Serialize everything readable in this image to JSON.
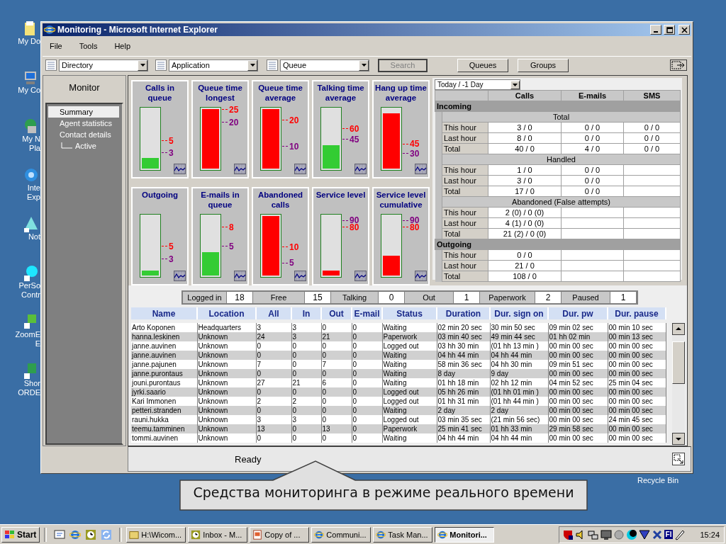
{
  "desktop_icons": [
    {
      "lines": [
        "My Do"
      ]
    },
    {
      "lines": [
        "My Co"
      ]
    },
    {
      "lines": [
        "My N",
        "Pla"
      ]
    },
    {
      "lines": [
        "Inte",
        "Exp"
      ]
    },
    {
      "lines": [
        "Not"
      ]
    },
    {
      "lines": [
        "PerSo",
        "Contr"
      ]
    },
    {
      "lines": [
        "ZoomE",
        "E"
      ]
    },
    {
      "lines": [
        "Shor",
        "ORDE"
      ]
    }
  ],
  "recycle_bin": {
    "label": "Recycle Bin"
  },
  "window": {
    "title": "Monitoring - Microsoft Internet Explorer"
  },
  "menu": [
    "File",
    "Tools",
    "Help"
  ],
  "toolbar": {
    "dropdowns": [
      "Directory",
      "Application",
      "Queue"
    ],
    "search": {
      "label": "Search",
      "disabled": true
    },
    "buttons": [
      "Queues",
      "Groups"
    ]
  },
  "sidebar": {
    "title": "Monitor",
    "items": [
      {
        "label": "Summary",
        "selected": true
      },
      {
        "label": "Agent statistics",
        "selected": false
      },
      {
        "label": "Contact details",
        "selected": false,
        "children": [
          {
            "label": "Active",
            "selected": false
          }
        ]
      }
    ]
  },
  "gauges": [
    {
      "title": "Calls in queue",
      "level": 0.18,
      "color": "#33cc33",
      "ticks": [
        {
          "label": "5",
          "color": "#ff0000"
        },
        {
          "label": "3",
          "color": "#800080"
        }
      ]
    },
    {
      "title": "Queue time longest",
      "level": 1,
      "color": "#ff0000",
      "ticks": [
        {
          "label": "25",
          "color": "#ff0000"
        },
        {
          "label": "20",
          "color": "#800080"
        }
      ]
    },
    {
      "title": "Queue time average",
      "level": 1,
      "color": "#ff0000",
      "ticks": [
        {
          "label": "20",
          "color": "#ff0000"
        },
        {
          "label": "10",
          "color": "#800080"
        }
      ]
    },
    {
      "title": "Talking time average",
      "level": 0.39,
      "color": "#33cc33",
      "ticks": [
        {
          "label": "60",
          "color": "#ff0000"
        },
        {
          "label": "45",
          "color": "#800080"
        }
      ]
    },
    {
      "title": "Hang up time average",
      "level": 0.93,
      "color": "#ff0000",
      "ticks": [
        {
          "label": "45",
          "color": "#ff0000"
        },
        {
          "label": "30",
          "color": "#800080"
        }
      ]
    },
    {
      "title": "Outgoing",
      "level": 0.08,
      "color": "#33cc33",
      "ticks": [
        {
          "label": "5",
          "color": "#ff0000"
        },
        {
          "label": "3",
          "color": "#800080"
        }
      ]
    },
    {
      "title": "E-mails in queue",
      "level": 0.39,
      "color": "#33cc33",
      "ticks": [
        {
          "label": "8",
          "color": "#ff0000"
        },
        {
          "label": "5",
          "color": "#800080"
        }
      ]
    },
    {
      "title": "Abandoned calls",
      "level": 1,
      "color": "#ff0000",
      "ticks": [
        {
          "label": "10",
          "color": "#ff0000"
        },
        {
          "label": "5",
          "color": "#800080"
        }
      ]
    },
    {
      "title": "Service level",
      "level": 0.08,
      "color": "#ff0000",
      "ticks": [
        {
          "label": "90",
          "color": "#800080"
        },
        {
          "label": "80",
          "color": "#ff0000"
        }
      ]
    },
    {
      "title": "Service level cumulative",
      "level": 0.33,
      "color": "#ff0000",
      "ticks": [
        {
          "label": "90",
          "color": "#800080"
        },
        {
          "label": "80",
          "color": "#ff0000"
        }
      ]
    }
  ],
  "stats": {
    "period": "Today / -1 Day",
    "columns": [
      "Calls",
      "E-mails",
      "SMS"
    ],
    "sections": [
      {
        "title": "Incoming",
        "groups": [
          {
            "title": "Total",
            "rows": [
              {
                "label": "This hour",
                "cells": [
                  "3 / 0",
                  "0 / 0",
                  "0 / 0"
                ]
              },
              {
                "label": "Last hour",
                "cells": [
                  "8 / 0",
                  "0 / 0",
                  "0 / 0"
                ]
              },
              {
                "label": "Total",
                "cells": [
                  "40 / 0",
                  "4 / 0",
                  "0 / 0"
                ]
              }
            ]
          },
          {
            "title": "Handled",
            "rows": [
              {
                "label": "This hour",
                "cells": [
                  "1 / 0",
                  "0 / 0"
                ]
              },
              {
                "label": "Last hour",
                "cells": [
                  "3 / 0",
                  "0 / 0"
                ]
              },
              {
                "label": "Total",
                "cells": [
                  "17 / 0",
                  "0 / 0"
                ]
              }
            ]
          },
          {
            "title": "Abandoned (False attempts)",
            "rows": [
              {
                "label": "This hour",
                "cells": [
                  "2 (0) / 0 (0)"
                ]
              },
              {
                "label": "Last hour",
                "cells": [
                  "4 (1) / 0 (0)"
                ]
              },
              {
                "label": "Total",
                "cells": [
                  "21 (2) / 0 (0)"
                ]
              }
            ]
          }
        ]
      },
      {
        "title": "Outgoing",
        "groups": [
          {
            "rows": [
              {
                "label": "This hour",
                "cells": [
                  "0 / 0"
                ]
              },
              {
                "label": "Last hour",
                "cells": [
                  "21 / 0"
                ]
              },
              {
                "label": "Total",
                "cells": [
                  "108 / 0"
                ]
              }
            ]
          }
        ]
      }
    ]
  },
  "summary": [
    {
      "label": "Logged in",
      "value": "18"
    },
    {
      "label": "Free",
      "value": "15"
    },
    {
      "label": "Talking",
      "value": "0"
    },
    {
      "label": "Out",
      "value": "1"
    },
    {
      "label": "Paperwork",
      "value": "2"
    },
    {
      "label": "Paused",
      "value": "1"
    }
  ],
  "agents": {
    "columns": [
      "Name",
      "Location",
      "All",
      "In",
      "Out",
      "E-mail",
      "Status",
      "Duration",
      "Dur. sign on",
      "Dur. pw",
      "Dur. pause"
    ],
    "rows": [
      [
        "Arto Koponen",
        "Headquarters",
        "3",
        "3",
        "0",
        "0",
        "Waiting",
        "02 min 20 sec",
        "30 min 50 sec",
        "09 min 02 sec",
        "00 min 10 sec"
      ],
      [
        "hanna.leskinen",
        "Unknown",
        "24",
        "3",
        "21",
        "0",
        "Paperwork",
        "03 min 40 sec",
        "49 min 44 sec",
        "01 hh 02 min",
        "00 min 13 sec"
      ],
      [
        "janne.auvinen",
        "Unknown",
        "0",
        "0",
        "0",
        "0",
        "Logged out",
        "03 hh 30 min",
        "(01 hh 13 min )",
        "00 min 00 sec",
        "00 min 00 sec"
      ],
      [
        "janne.auvinen",
        "Unknown",
        "0",
        "0",
        "0",
        "0",
        "Waiting",
        "04 hh 44 min",
        "04 hh 44 min",
        "00 min 00 sec",
        "00 min 00 sec"
      ],
      [
        "janne.pajunen",
        "Unknown",
        "7",
        "0",
        "7",
        "0",
        "Waiting",
        "58 min 36 sec",
        "04 hh 30 min",
        "09 min 51 sec",
        "00 min 00 sec"
      ],
      [
        "janne.purontaus",
        "Unknown",
        "0",
        "0",
        "0",
        "0",
        "Waiting",
        "8 day",
        "9 day",
        "00 min 00 sec",
        "00 min 00 sec"
      ],
      [
        "jouni.purontaus",
        "Unknown",
        "27",
        "21",
        "6",
        "0",
        "Waiting",
        "01 hh 18 min",
        "02 hh 12 min",
        "04 min 52 sec",
        "25 min 04 sec"
      ],
      [
        "jyrki.saario",
        "Unknown",
        "0",
        "0",
        "0",
        "0",
        "Logged out",
        "05 hh 26 min",
        "(01 hh 01 min )",
        "00 min 00 sec",
        "00 min 00 sec"
      ],
      [
        "Kari Immonen",
        "Unknown",
        "2",
        "2",
        "0",
        "0",
        "Logged out",
        "01 hh 31 min",
        "(01 hh 44 min )",
        "00 min 00 sec",
        "00 min 00 sec"
      ],
      [
        "petteri.stranden",
        "Unknown",
        "0",
        "0",
        "0",
        "0",
        "Waiting",
        "2 day",
        "2 day",
        "00 min 00 sec",
        "00 min 00 sec"
      ],
      [
        "rauni.hukka",
        "Unknown",
        "3",
        "3",
        "0",
        "0",
        "Logged out",
        "03 min 35 sec",
        "(21 min 56 sec)",
        "00 min 00 sec",
        "24 min 45 sec"
      ],
      [
        "teemu.tamminen",
        "Unknown",
        "13",
        "0",
        "13",
        "0",
        "Paperwork",
        "25 min 41 sec",
        "01 hh 33 min",
        "29 min 58 sec",
        "00 min 00 sec"
      ],
      [
        "tommi.auvinen",
        "Unknown",
        "0",
        "0",
        "0",
        "0",
        "Waiting",
        "04 hh 44 min",
        "04 hh 44 min",
        "00 min 00 sec",
        "00 min 00 sec"
      ]
    ]
  },
  "status_bar": "Ready",
  "caption": "Средства мониторинга в режиме реального времени",
  "taskbar": {
    "start": "Start",
    "tasks": [
      {
        "label": "H:\\Wicom...",
        "selected": false
      },
      {
        "label": "Inbox - M...",
        "selected": false
      },
      {
        "label": "Copy of ...",
        "selected": false
      },
      {
        "label": "Communi...",
        "selected": false
      },
      {
        "label": "Task Man...",
        "selected": false
      },
      {
        "label": "Monitori...",
        "selected": true
      }
    ],
    "language": "FI",
    "clock": "15:24"
  }
}
